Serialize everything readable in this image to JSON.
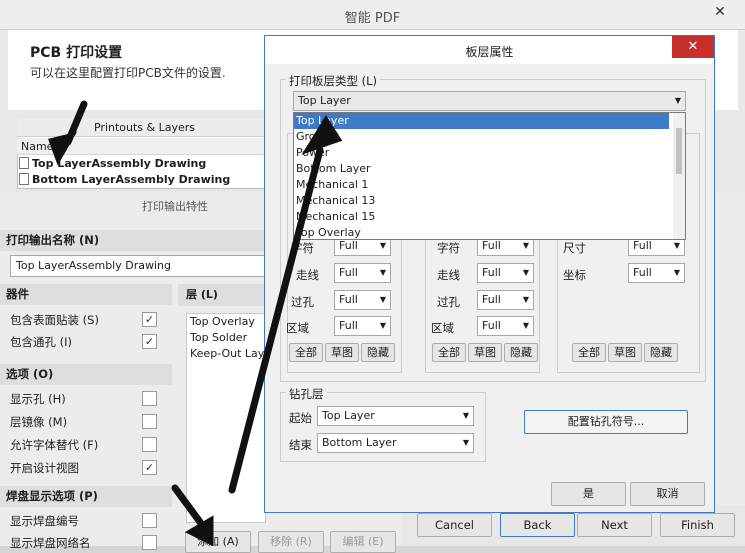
{
  "window": {
    "title": "智能 PDF",
    "close": "✕"
  },
  "header": {
    "title": "PCB 打印设置",
    "subtitle": "可以在这里配置打印PCB文件的设置."
  },
  "printouts": {
    "header": "Printouts & Layers",
    "name_col": "Name",
    "rows": [
      "Top LayerAssembly Drawing",
      "Bottom LayerAssembly Drawing"
    ]
  },
  "props": {
    "title": "打印输出特性",
    "name_section": "打印输出名称 (N)",
    "name_value": "Top LayerAssembly Drawing",
    "components_section": "器件",
    "components": [
      {
        "label": "包含表面贴装 (S)",
        "checked": "✓"
      },
      {
        "label": "包含通孔 (I)",
        "checked": "✓"
      }
    ],
    "options_section": "选项 (O)",
    "options": [
      {
        "label": "显示孔 (H)",
        "checked": ""
      },
      {
        "label": "层镜像 (M)",
        "checked": ""
      },
      {
        "label": "允许字体替代 (F)",
        "checked": ""
      },
      {
        "label": "开启设计视图",
        "checked": "✓"
      }
    ],
    "pad_section": "焊盘显示选项 (P)",
    "pads": [
      {
        "label": "显示焊盘编号",
        "checked": ""
      },
      {
        "label": "显示焊盘网络名",
        "checked": ""
      }
    ],
    "layers_section": "层 (L)",
    "layers": [
      "Top Overlay",
      "Top Solder",
      "Keep-Out Layer"
    ],
    "add": "添加 (A)",
    "remove": "移除 (R)",
    "edit": "编辑 (E)"
  },
  "nav": {
    "cancel": "Cancel",
    "back": "Back",
    "next": "Next",
    "finish": "Finish"
  },
  "dialog": {
    "title": "板层属性",
    "close": "✕",
    "layer_type_label": "打印板层类型 (L)",
    "layer_type_value": "Top Layer",
    "dropdown_items": [
      "Top Layer",
      "Ground",
      "Power",
      "Bottom Layer",
      "Mechanical 1",
      "Mechanical 13",
      "Mechanical 15",
      "Top Overlay"
    ],
    "selected_index": 0,
    "col1": {
      "rows": [
        {
          "label": "字符",
          "value": "Full"
        },
        {
          "label": "走线",
          "value": "Full"
        },
        {
          "label": "过孔",
          "value": "Full"
        },
        {
          "label": "区域",
          "value": "Full"
        }
      ]
    },
    "col2": {
      "rows": [
        {
          "label": "字符",
          "value": "Full"
        },
        {
          "label": "走线",
          "value": "Full"
        },
        {
          "label": "过孔",
          "value": "Full"
        },
        {
          "label": "区域",
          "value": "Full"
        }
      ]
    },
    "col3": {
      "rows": [
        {
          "label": "尺寸",
          "value": "Full"
        },
        {
          "label": "坐标",
          "value": "Full"
        }
      ]
    },
    "btn_all": "全部",
    "btn_draft": "草图",
    "btn_hide": "隐藏",
    "drill_section": "钻孔层",
    "drill_start_label": "起始",
    "drill_start_value": "Top Layer",
    "drill_end_label": "结束",
    "drill_end_value": "Bottom Layer",
    "drill_config": "配置钻孔符号...",
    "ok": "是",
    "cancel": "取消"
  },
  "colors": {
    "accent": "#3d7bc8",
    "close_red": "#c7302a"
  }
}
